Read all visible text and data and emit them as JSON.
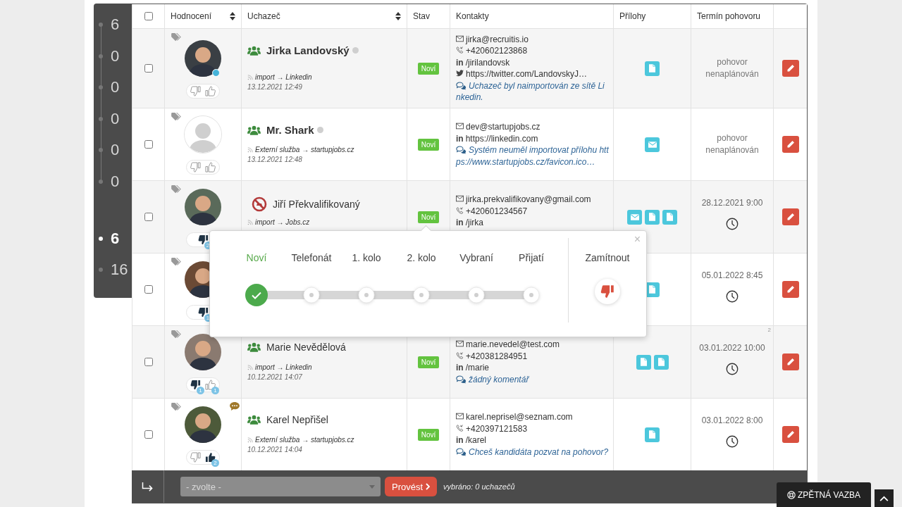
{
  "sidebar": {
    "pipeline": [
      {
        "count": "6",
        "selected": false
      },
      {
        "count": "0",
        "selected": false
      },
      {
        "count": "0",
        "selected": false
      },
      {
        "count": "0",
        "selected": false
      },
      {
        "count": "0",
        "selected": false
      },
      {
        "count": "0",
        "selected": false
      }
    ],
    "totals": [
      {
        "count": "6",
        "selected": true
      },
      {
        "count": "16",
        "selected": false
      }
    ]
  },
  "table": {
    "select_all": {
      "checked": false
    },
    "columns": [
      {
        "label": "Hodnocení",
        "sortable": true
      },
      {
        "label": "Uchazeč",
        "sortable": true
      },
      {
        "label": "Stav",
        "sortable": false
      },
      {
        "label": "Kontakty",
        "sortable": false
      },
      {
        "label": "Přílohy",
        "sortable": false
      },
      {
        "label": "Termín pohovoru",
        "sortable": false
      }
    ],
    "rows": [
      {
        "checked": false,
        "avatar": {
          "kind": "photo"
        },
        "online": true,
        "note": false,
        "votes": [
          {
            "kind": "down",
            "filled": false
          },
          {
            "kind": "up",
            "filled": false
          }
        ],
        "name_icon": {
          "kind": "group"
        },
        "name": "Jirka Landovský",
        "bold": true,
        "presence_dot": true,
        "source": "import → Linkedin",
        "date": "13.12.2021 12:49",
        "status": "Noví",
        "contacts": [
          {
            "kind": "email",
            "text": "jirka@recruitis.io"
          },
          {
            "kind": "phone",
            "text": "+420602123868"
          },
          {
            "kind": "linkedin",
            "icon": "in",
            "text": "/jirilandovsk"
          },
          {
            "kind": "twitter",
            "text": "https://twitter.com/LandovskyJ…"
          }
        ],
        "comment": "Uchazeč byl naimportován ze sítě Linkedin.",
        "attachments": [
          {
            "kind": "doc"
          }
        ],
        "interview": {
          "kind": "none",
          "text": "pohovor nenaplánován"
        }
      },
      {
        "checked": false,
        "avatar": {
          "kind": "default"
        },
        "online": false,
        "note": false,
        "votes": [
          {
            "kind": "down",
            "filled": false
          },
          {
            "kind": "up",
            "filled": false
          }
        ],
        "name_icon": {
          "kind": "group"
        },
        "name": "Mr. Shark",
        "bold": true,
        "presence_dot": true,
        "source": "Externí služba → startupjobs.cz",
        "date": "13.12.2021 12:48",
        "status": "Noví",
        "contacts": [
          {
            "kind": "email",
            "text": "dev@startupjobs.cz"
          },
          {
            "kind": "linkedin",
            "icon": "in",
            "text": "https://linkedin.com"
          }
        ],
        "comment": "Systém neuměl importovat přílohu https://www.startupjobs.cz/favicon.ico…",
        "attachments": [
          {
            "kind": "mail"
          }
        ],
        "interview": {
          "kind": "none",
          "text": "pohovor nenaplánován"
        }
      },
      {
        "checked": false,
        "avatar": {
          "kind": "photo"
        },
        "online": false,
        "note": false,
        "votes": [
          {
            "kind": "down",
            "filled": true,
            "count": "2"
          }
        ],
        "name_icon": {
          "kind": "blocked"
        },
        "name": "Jiří Překvalifikovaný",
        "bold": false,
        "presence_dot": false,
        "source": "import → Jobs.cz",
        "status": "Noví",
        "contacts": [
          {
            "kind": "email",
            "text": "jirka.prekvalifikovany@gmail.com"
          },
          {
            "kind": "phone",
            "text": "+420601234567"
          },
          {
            "kind": "linkedin",
            "icon": "in",
            "text": "/jirka"
          }
        ],
        "attachments": [
          {
            "kind": "mail"
          },
          {
            "kind": "doc"
          },
          {
            "kind": "doc"
          }
        ],
        "interview": {
          "kind": "date",
          "text": "28.12.2021 9:00"
        }
      },
      {
        "checked": false,
        "avatar": {
          "kind": "photo"
        },
        "online": false,
        "note": false,
        "votes": [
          {
            "kind": "down",
            "filled": true,
            "count": "1"
          }
        ],
        "contacts": [],
        "attachments": [
          {
            "kind": "doc"
          }
        ],
        "interview": {
          "kind": "date",
          "text": "05.01.2022 8:45"
        }
      },
      {
        "checked": false,
        "avatar": {
          "kind": "photo"
        },
        "online": false,
        "note": false,
        "votes": [
          {
            "kind": "down",
            "filled": true,
            "count": "1"
          },
          {
            "kind": "up",
            "filled": false,
            "count": "1"
          }
        ],
        "name_icon": {
          "kind": "group"
        },
        "name": "Marie Nevědělová",
        "bold": false,
        "presence_dot": false,
        "source": "import → Linkedin",
        "date": "10.12.2021 14:07",
        "status": "Noví",
        "contacts": [
          {
            "kind": "email",
            "text": "marie.nevedel@test.com"
          },
          {
            "kind": "phone",
            "text": "+420381284951"
          },
          {
            "kind": "linkedin",
            "icon": "in",
            "text": "/marie"
          }
        ],
        "comment": "žádný komentář",
        "attachments": [
          {
            "kind": "doc"
          },
          {
            "kind": "doc"
          }
        ],
        "interview": {
          "kind": "date",
          "text": "03.01.2022 10:00",
          "corner": "2"
        }
      },
      {
        "checked": false,
        "avatar": {
          "kind": "photo"
        },
        "online": false,
        "note": true,
        "votes": [
          {
            "kind": "down",
            "filled": false
          },
          {
            "kind": "up",
            "filled": true,
            "count": "2"
          }
        ],
        "name_icon": {
          "kind": "group"
        },
        "name": "Karel Nepřišel",
        "bold": false,
        "presence_dot": false,
        "source": "Externí služba → startupjobs.cz",
        "date": "10.12.2021 14:04",
        "status": "Noví",
        "contacts": [
          {
            "kind": "email",
            "text": "karel.neprisel@seznam.com"
          },
          {
            "kind": "phone",
            "text": "+420397121583"
          },
          {
            "kind": "linkedin",
            "icon": "in",
            "text": "/karel"
          }
        ],
        "comment": "Chceš kandidáta pozvat na pohovor?",
        "attachments": [
          {
            "kind": "doc"
          }
        ],
        "interview": {
          "kind": "date",
          "text": "03.01.2022 8:00"
        }
      }
    ]
  },
  "stage_popup": {
    "close": "×",
    "stages": [
      {
        "label": "Noví",
        "selected": true,
        "done": true
      },
      {
        "label": "Telefonát",
        "selected": false,
        "done": false
      },
      {
        "label": "1. kolo",
        "selected": false,
        "done": false
      },
      {
        "label": "2. kolo",
        "selected": false,
        "done": false
      },
      {
        "label": "Vybraní",
        "selected": false,
        "done": false
      },
      {
        "label": "Přijatí",
        "selected": false,
        "done": false
      }
    ],
    "reject": "Zamítnout"
  },
  "footer": {
    "action": "- zvolte -",
    "button": "Provést",
    "selected_info": "vybráno: 0 uchazečů"
  },
  "feedback": "ZPĚTNÁ VAZBA"
}
